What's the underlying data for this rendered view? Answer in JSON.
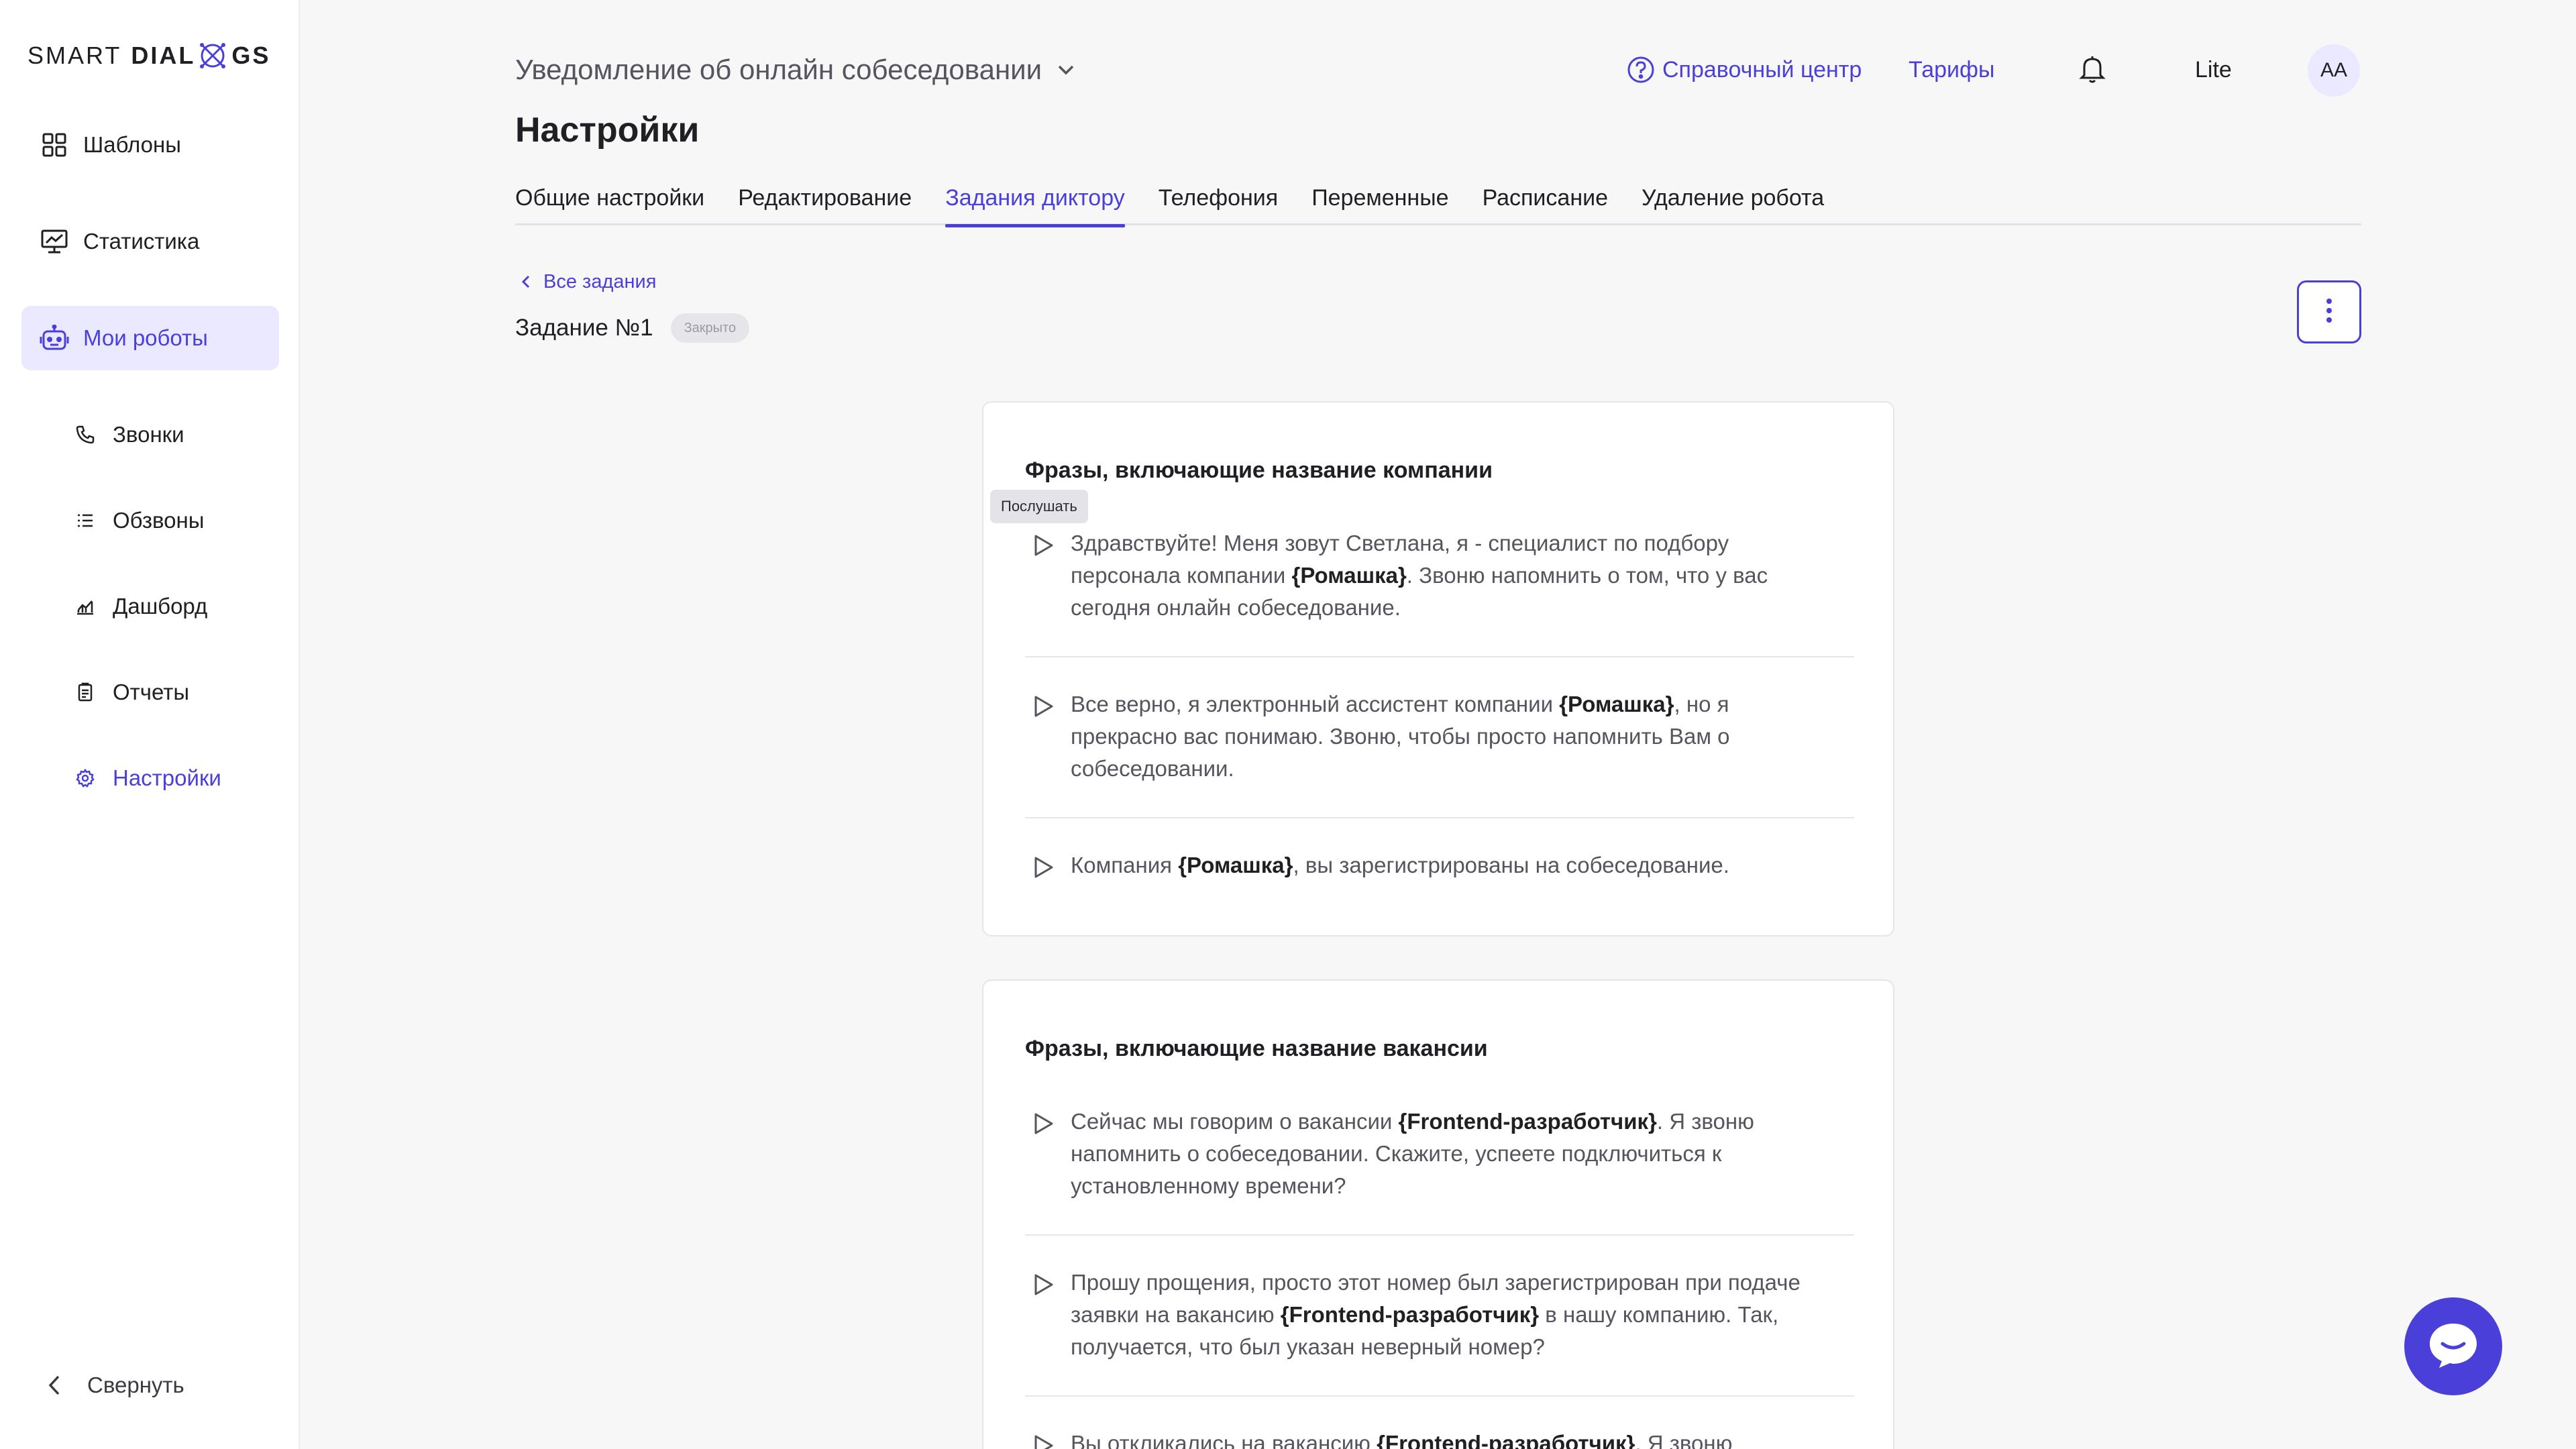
{
  "brand": {
    "logo_left": "SMART",
    "logo_right_1": "DIAL",
    "logo_right_2": "GS"
  },
  "sidebar": {
    "items": [
      {
        "label": "Шаблоны",
        "icon": "grid-icon"
      },
      {
        "label": "Статистика",
        "icon": "chart-monitor-icon"
      },
      {
        "label": "Мои роботы",
        "icon": "robot-icon"
      }
    ],
    "sub_items": [
      {
        "label": "Звонки",
        "icon": "phone-icon"
      },
      {
        "label": "Обзвоны",
        "icon": "list-icon"
      },
      {
        "label": "Дашборд",
        "icon": "dashboard-icon"
      },
      {
        "label": "Отчеты",
        "icon": "report-icon"
      },
      {
        "label": "Настройки",
        "icon": "settings-icon"
      }
    ],
    "collapse_label": "Свернуть"
  },
  "header": {
    "robot_name": "Уведомление об онлайн собеседовании",
    "help_label": "Справочный центр",
    "tariffs_label": "Тарифы",
    "plan": "Lite",
    "avatar_initials": "AA"
  },
  "page": {
    "title": "Настройки",
    "tabs": [
      "Общие настройки",
      "Редактирование",
      "Задания диктору",
      "Телефония",
      "Переменные",
      "Расписание",
      "Удаление робота"
    ],
    "active_tab": "Задания диктору",
    "back_label": "Все задания",
    "task_title": "Задание №1",
    "task_status": "Закрыто"
  },
  "tooltip": "Послушать",
  "cards": [
    {
      "title": "Фразы, включающие название компании",
      "phrases": [
        {
          "before": "Здравствуйте! Меня зовут Светлана, я - специалист по подбору персонала компании ",
          "var": "{Ромашка}",
          "after": ". Звоню напомнить о том, что у вас сегодня онлайн собеседование."
        },
        {
          "before": "Все верно, я электронный ассистент компании ",
          "var": "{Ромашка}",
          "after": ", но я прекрасно вас понимаю. Звоню, чтобы просто напомнить Вам о собеседовании."
        },
        {
          "before": "Компания ",
          "var": "{Ромашка}",
          "after": ", вы зарегистрированы на собеседование."
        }
      ]
    },
    {
      "title": "Фразы, включающие название вакансии",
      "phrases": [
        {
          "before": "Сейчас мы говорим о вакансии ",
          "var": "{Frontend-разработчик}",
          "after": ". Я звоню напомнить о собеседовании. Скажите, успеете подключиться к установленному времени?"
        },
        {
          "before": "Прошу прощения, просто этот номер был зарегистрирован при подаче заявки на вакансию ",
          "var": "{Frontend-разработчик}",
          "after": " в нашу компанию. Так, получается, что был указан неверный номер?"
        },
        {
          "before": "Вы откликались на вакансию ",
          "var": "{Frontend-разработчик}",
          "after": ". Я звоню"
        }
      ]
    }
  ],
  "colors": {
    "accent": "#4b3fd9",
    "accent_light": "#ebe9ff",
    "background": "#f7f7f8"
  }
}
